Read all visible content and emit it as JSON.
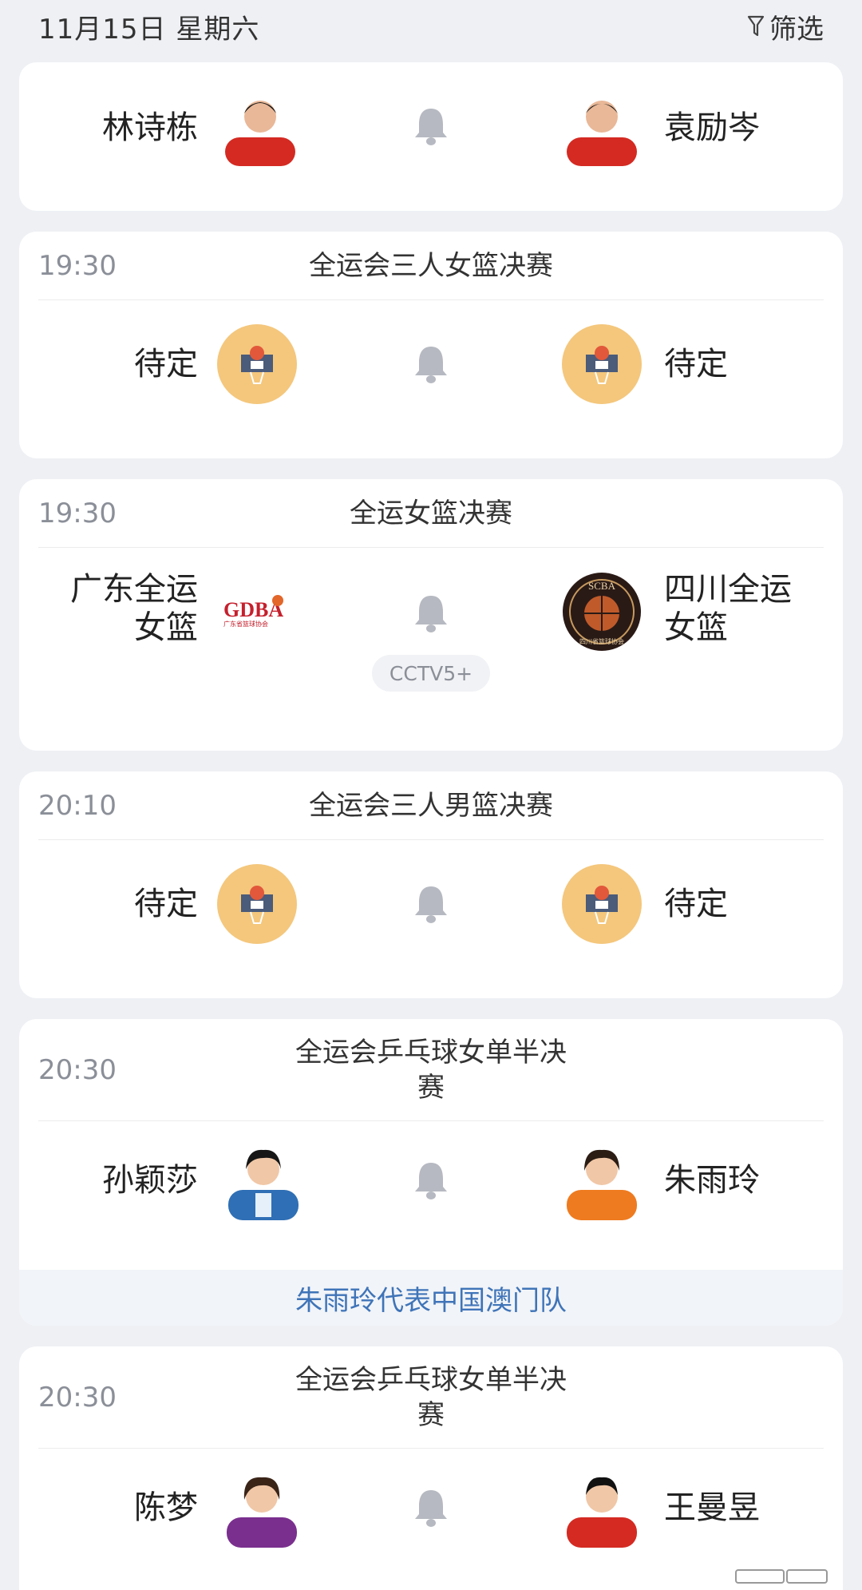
{
  "header": {
    "date": "11月15日 星期六",
    "filter_label": "筛选"
  },
  "matches": [
    {
      "left": "林诗栋",
      "right": "袁励岑"
    },
    {
      "time": "19:30",
      "event": "全运会三人女篮决赛",
      "left": "待定",
      "right": "待定"
    },
    {
      "time": "19:30",
      "event": "全运女篮决赛",
      "left_line1": "广东全运",
      "left_line2": "女篮",
      "right_line1": "四川全运",
      "right_line2": "女篮",
      "tv": "CCTV5+",
      "left_logo_text": "GDBA",
      "left_logo_sub": "广东省篮球协会",
      "right_logo_text": "SCBA",
      "right_logo_sub": "四川省篮球协会"
    },
    {
      "time": "20:10",
      "event": "全运会三人男篮决赛",
      "left": "待定",
      "right": "待定"
    },
    {
      "time": "20:30",
      "event_line1": "全运会乒乓球女单半决",
      "event_line2": "赛",
      "left": "孙颖莎",
      "right": "朱雨玲",
      "note": "朱雨玲代表中国澳门队"
    },
    {
      "time": "20:30",
      "event_line1": "全运会乒乓球女单半决",
      "event_line2": "赛",
      "left": "陈梦",
      "right": "王曼昱"
    }
  ],
  "colors": {
    "note_text": "#3f74b8",
    "accent_ball": "#f4c77d",
    "bell": "#b6b9c1"
  },
  "icons": [
    "filter-icon",
    "bell-icon",
    "basketball-logo-icon",
    "player-avatar"
  ]
}
